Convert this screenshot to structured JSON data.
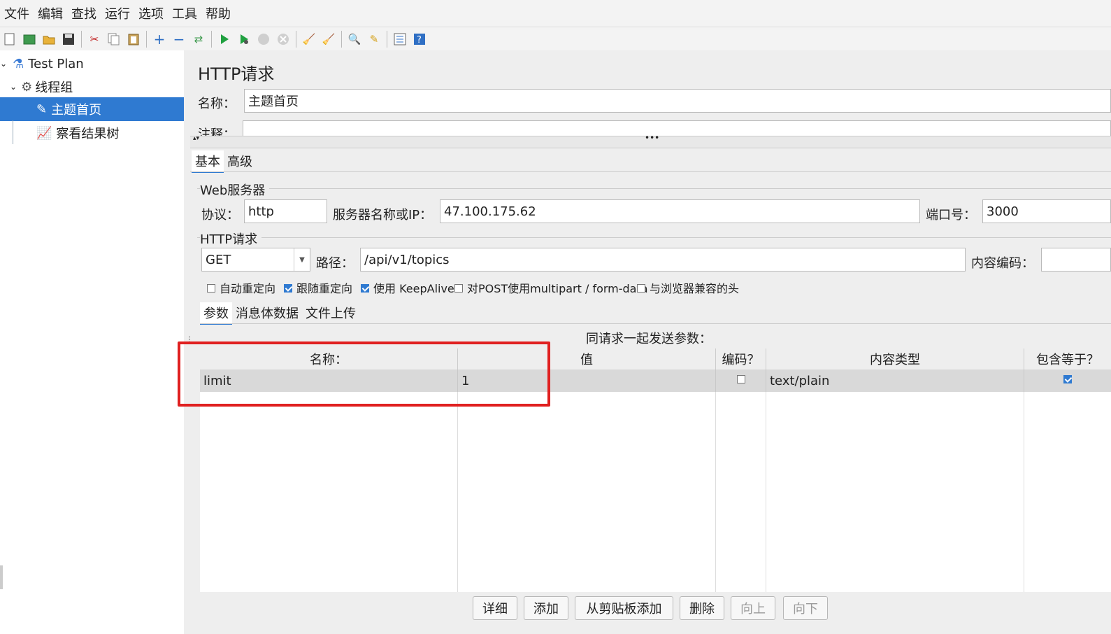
{
  "menu": [
    "文件",
    "编辑",
    "查找",
    "运行",
    "选项",
    "工具",
    "帮助"
  ],
  "tree": {
    "test_plan": "Test Plan",
    "thread_group": "线程组",
    "sampler": "主题首页",
    "listener": "察看结果树"
  },
  "panel": {
    "title": "HTTP请求",
    "name_label": "名称：",
    "name_value": "主题首页",
    "comment_label": "注释：",
    "tabs": [
      "基本",
      "高级"
    ],
    "web_server": {
      "legend": "Web服务器",
      "protocol_label": "协议：",
      "protocol_value": "http",
      "server_label": "服务器名称或IP：",
      "server_value": "47.100.175.62",
      "port_label": "端口号：",
      "port_value": "3000"
    },
    "http_request": {
      "legend": "HTTP请求",
      "method": "GET",
      "path_label": "路径：",
      "path_value": "/api/v1/topics",
      "encoding_label": "内容编码："
    },
    "options": [
      {
        "label": "自动重定向",
        "checked": false
      },
      {
        "label": "跟随重定向",
        "checked": true
      },
      {
        "label": "使用 KeepAlive",
        "checked": true
      },
      {
        "label": "对POST使用multipart / form-data",
        "checked": false
      },
      {
        "label": "与浏览器兼容的头",
        "checked": false
      }
    ],
    "subtabs": [
      "参数",
      "消息体数据",
      "文件上传"
    ],
    "params_caption": "同请求一起发送参数：",
    "columns": [
      "名称：",
      "值",
      "编码？",
      "内容类型",
      "包含等于？"
    ],
    "row": {
      "name": "limit",
      "value": "1",
      "encode": false,
      "content_type": "text/plain",
      "include_equals": true
    },
    "buttons": {
      "detail": "详细",
      "add": "添加",
      "paste": "从剪贴板添加",
      "delete": "删除",
      "up": "向上",
      "down": "向下"
    }
  },
  "colors": {
    "accent": "#2f7ad1",
    "highlight": "#e02020"
  }
}
